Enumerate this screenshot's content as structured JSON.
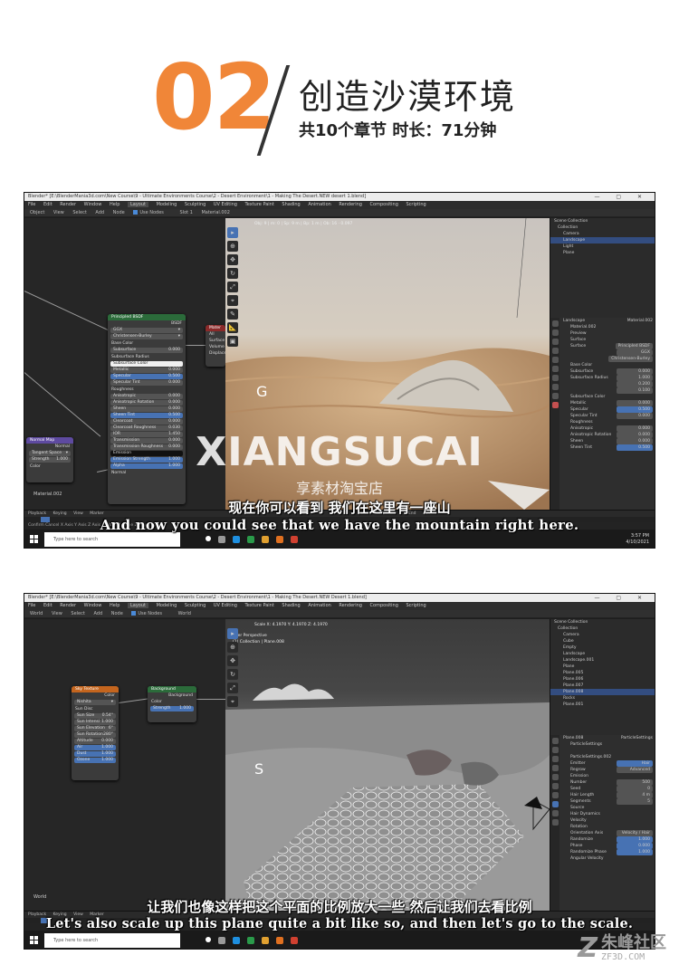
{
  "header": {
    "number": "02",
    "title": "创造沙漠环境",
    "subtitle": "共10个章节  时长：71分钟"
  },
  "watermark": {
    "text": "XIANGSUCAI",
    "subtext": "享素材淘宝店"
  },
  "brand": {
    "name": "朱峰社区",
    "url": "ZF3D.COM"
  },
  "shot1": {
    "title": "Blender* [E:\\BlenderMania3d.com\\New Course\\9 - Ultimate Environments Course\\2 - Desert Environment\\1 - Making The Desert.NEW desert 1.blend]",
    "menu": [
      "File",
      "Edit",
      "Render",
      "Window",
      "Help"
    ],
    "workspaces": [
      "Layout",
      "Modeling",
      "Sculpting",
      "UV Editing",
      "Texture Paint",
      "Shading",
      "Animation",
      "Rendering",
      "Compositing",
      "Scripting"
    ],
    "toolbar": [
      "Object",
      "View",
      "Select",
      "Add",
      "Node",
      "Use Nodes",
      "Slot 1",
      "Material.002"
    ],
    "viewport_info": "Obj: 9 | m: 0 | Sp: 9 m | Bp: 1 m | Ob: 16 · 0.097",
    "key_hint": "G",
    "node_principled": {
      "title": "Principled BSDF",
      "out": "BSDF",
      "dist": "GGX",
      "sss": "Christensen-Burley",
      "rows": [
        {
          "label": "Base Color",
          "value": ""
        },
        {
          "label": "Subsurface",
          "value": "0.000"
        },
        {
          "label": "Subsurface Radius",
          "value": ""
        },
        {
          "label": "Subsurface Color",
          "value": ""
        },
        {
          "label": "Metallic",
          "value": "0.000"
        },
        {
          "label": "Specular",
          "value": "0.500"
        },
        {
          "label": "Specular Tint",
          "value": "0.000"
        },
        {
          "label": "Roughness",
          "value": ""
        },
        {
          "label": "Anisotropic",
          "value": "0.000"
        },
        {
          "label": "Anisotropic Rotation",
          "value": "0.000"
        },
        {
          "label": "Sheen",
          "value": "0.000"
        },
        {
          "label": "Sheen Tint",
          "value": "0.500"
        },
        {
          "label": "Clearcoat",
          "value": "0.000"
        },
        {
          "label": "Clearcoat Roughness",
          "value": "0.030"
        },
        {
          "label": "IOR",
          "value": "1.450"
        },
        {
          "label": "Transmission",
          "value": "0.000"
        },
        {
          "label": "Transmission Roughness",
          "value": "0.000"
        },
        {
          "label": "Emission",
          "value": ""
        },
        {
          "label": "Emission Strength",
          "value": "1.000"
        },
        {
          "label": "Alpha",
          "value": "1.000"
        },
        {
          "label": "Normal",
          "value": ""
        }
      ]
    },
    "node_normal": {
      "title": "Normal Map",
      "out": "Normal",
      "space": "Tangent Space",
      "strength_label": "Strength",
      "strength": "1.000",
      "color": "Color"
    },
    "node_output": {
      "title": "Mater",
      "rows": [
        "All",
        "Surface",
        "Volume",
        "Displace"
      ]
    },
    "material_label": "Material.002",
    "outliner": [
      {
        "label": "Scene Collection",
        "sel": false
      },
      {
        "label": "Collection",
        "sel": false
      },
      {
        "label": "Camera",
        "sel": false
      },
      {
        "label": "Landscape",
        "sel": true
      },
      {
        "label": "Light",
        "sel": false
      },
      {
        "label": "Plane",
        "sel": false
      }
    ],
    "props_header": [
      "Landscape",
      "Material.002"
    ],
    "props": [
      {
        "label": "Material.002",
        "value": ""
      },
      {
        "label": "Preview",
        "value": ""
      },
      {
        "label": "Surface",
        "value": ""
      },
      {
        "label": "Surface",
        "value": "Principled BSDF"
      },
      {
        "label": "",
        "value": "GGX"
      },
      {
        "label": "",
        "value": "Christensen-Burley"
      },
      {
        "label": "Base Color",
        "value": ""
      },
      {
        "label": "Subsurface",
        "value": "0.000"
      },
      {
        "label": "Subsurface Radius",
        "value": "1.000"
      },
      {
        "label": "",
        "value": "0.200"
      },
      {
        "label": "",
        "value": "0.100"
      },
      {
        "label": "Subsurface Color",
        "value": ""
      },
      {
        "label": "Metallic",
        "value": "0.000"
      },
      {
        "label": "Specular",
        "value": "0.500"
      },
      {
        "label": "Specular Tint",
        "value": "0.000"
      },
      {
        "label": "Roughness",
        "value": ""
      },
      {
        "label": "Anisotropic",
        "value": "0.000"
      },
      {
        "label": "Anisotropic Rotation",
        "value": "0.000"
      },
      {
        "label": "Sheen",
        "value": "0.000"
      },
      {
        "label": "Sheen Tint",
        "value": "0.500"
      }
    ],
    "timeline": [
      "Playback",
      "Keying",
      "View",
      "Marker"
    ],
    "timeline_right": [
      "Start",
      "1",
      "End",
      "250"
    ],
    "status": "Confirm  Cancel  X Axis  Y Axis  Z Axis  X Plane  Y Plane  Z Plane",
    "taskbar_search": "Type here to search",
    "clock": [
      "3:57 PM",
      "4/10/2021"
    ],
    "sub_zh": "现在你可以看到 我们在这里有一座山",
    "sub_en": "And now you could see that we have the mountain right here."
  },
  "shot2": {
    "title": "Blender* [E:\\BlenderMania3d.com\\New Course\\9 - Ultimate Environments Course\\2 - Desert Environment\\1 - Making The Desert.NEW Desert 1.blend]",
    "menu": [
      "File",
      "Edit",
      "Render",
      "Window",
      "Help"
    ],
    "workspaces": [
      "Layout",
      "Modeling",
      "Sculpting",
      "UV Editing",
      "Texture Paint",
      "Shading",
      "Animation",
      "Rendering",
      "Compositing",
      "Scripting"
    ],
    "toolbar": [
      "World",
      "View",
      "Select",
      "Add",
      "Node",
      "Use Nodes",
      "World"
    ],
    "viewport_info": "Scale X: 4.1970  Y: 4.1970  Z: 4.1970",
    "viewport_info2": "User Perspective",
    "viewport_info3": "(1) Collection | Plane.008",
    "key_hint": "S",
    "node_sky": {
      "title": "Sky Texture",
      "out": "Color",
      "model": "Nishita",
      "sundisc": "Sun Disc",
      "rows": [
        {
          "label": "Sun Size",
          "value": "0.54°"
        },
        {
          "label": "Sun Intensi",
          "value": "1.000"
        },
        {
          "label": "Sun Elevation",
          "value": "6°"
        },
        {
          "label": "Sun Rotation",
          "value": "280°"
        },
        {
          "label": "Altitude",
          "value": "0.000"
        },
        {
          "label": "Air",
          "value": "1.000"
        },
        {
          "label": "Dust",
          "value": "1.000"
        },
        {
          "label": "Ozone",
          "value": "1.000"
        }
      ]
    },
    "node_background": {
      "title": "Background",
      "out": "Background",
      "color": "Color",
      "strength_label": "Strength",
      "strength": "1.000"
    },
    "world_label": "World",
    "outliner": [
      {
        "label": "Scene Collection",
        "sel": false
      },
      {
        "label": "Collection",
        "sel": false
      },
      {
        "label": "Camera",
        "sel": false
      },
      {
        "label": "Cube",
        "sel": false
      },
      {
        "label": "Empty",
        "sel": false
      },
      {
        "label": "Landscape",
        "sel": false
      },
      {
        "label": "Landscape.001",
        "sel": false
      },
      {
        "label": "Plane",
        "sel": false
      },
      {
        "label": "Plane.005",
        "sel": false
      },
      {
        "label": "Plane.006",
        "sel": false
      },
      {
        "label": "Plane.007",
        "sel": false
      },
      {
        "label": "Plane.008",
        "sel": true
      },
      {
        "label": "Rocks",
        "sel": false
      },
      {
        "label": "Plane.001",
        "sel": false
      }
    ],
    "props_header": [
      "Plane.008",
      "ParticleSettings"
    ],
    "props": [
      {
        "label": "ParticleSettings",
        "value": ""
      },
      {
        "label": "",
        "value": ""
      },
      {
        "label": "ParticleSettings.002",
        "value": ""
      },
      {
        "label": "Emitter",
        "value": "Hair"
      },
      {
        "label": "Regrow",
        "value": "Advanced"
      },
      {
        "label": "Emission",
        "value": ""
      },
      {
        "label": "Number",
        "value": "500"
      },
      {
        "label": "Seed",
        "value": "0"
      },
      {
        "label": "Hair Length",
        "value": "4 m"
      },
      {
        "label": "Segments",
        "value": "5"
      },
      {
        "label": "Source",
        "value": ""
      },
      {
        "label": "Hair Dynamics",
        "value": ""
      },
      {
        "label": "Velocity",
        "value": ""
      },
      {
        "label": "Rotation",
        "value": ""
      },
      {
        "label": "Orientation Axis",
        "value": "Velocity / Hair"
      },
      {
        "label": "Randomize",
        "value": "1.000"
      },
      {
        "label": "Phase",
        "value": "0.000"
      },
      {
        "label": "Randomize Phase",
        "value": "1.000"
      },
      {
        "label": "Angular Velocity",
        "value": ""
      }
    ],
    "timeline": [
      "Playback",
      "Keying",
      "View",
      "Marker"
    ],
    "timeline_right": [],
    "status": "",
    "taskbar_search": "Type here to search",
    "clock": [],
    "sub_zh": "让我们也像这样把这个平面的比例放大一些 然后让我们去看比例",
    "sub_en": "Let's also scale up this plane quite a bit like so, and then let's go to the scale."
  },
  "colors": {
    "accent_orange": "#f08638",
    "blender_blue": "#4772b3",
    "node_shader_green": "#2b6b3a",
    "node_texture_orange": "#c4651e",
    "node_vector_purple": "#5e4aa0"
  }
}
